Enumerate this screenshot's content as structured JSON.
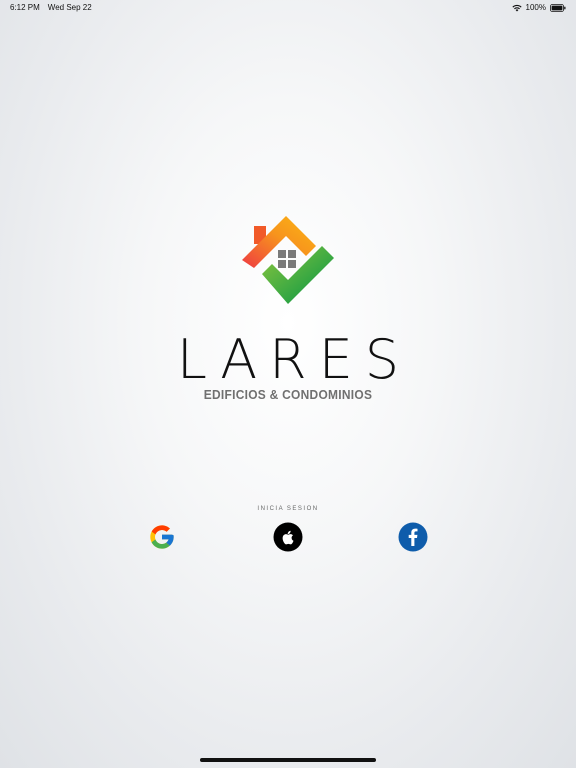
{
  "status_bar": {
    "time": "6:12 PM",
    "date": "Wed Sep 22",
    "battery": "100%",
    "icons": [
      "wifi-icon",
      "battery-icon"
    ]
  },
  "brand": {
    "title": "LARES",
    "subtitle": "EDIFICIOS & CONDOMINIOS",
    "logo_icon": "house-check-logo-icon",
    "colors": {
      "orange": "#f7941d",
      "red": "#ee3a43",
      "yellow": "#fcb813",
      "green_light": "#8dc63f",
      "green_dark": "#009444",
      "window_gray": "#7a7a7a"
    }
  },
  "signin": {
    "label": "INICIA SESION",
    "providers": [
      {
        "name": "Google",
        "icon": "google-icon",
        "color": "#4285f4"
      },
      {
        "name": "Apple",
        "icon": "apple-icon",
        "color": "#000000"
      },
      {
        "name": "Facebook",
        "icon": "facebook-icon",
        "color": "#1877f2"
      }
    ]
  }
}
